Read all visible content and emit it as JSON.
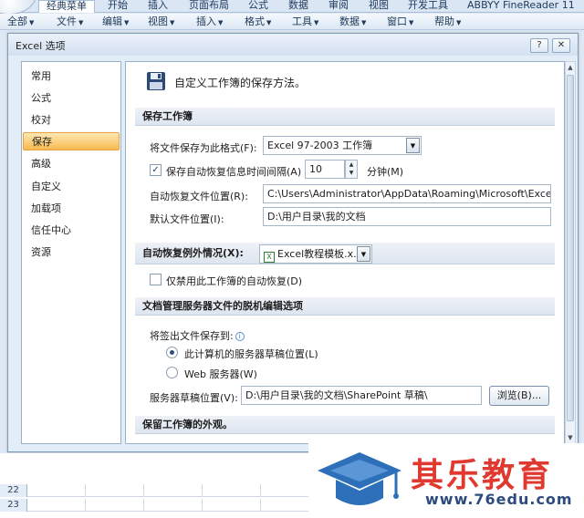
{
  "ribbon": {
    "tabs": [
      "经典菜单",
      "开始",
      "插入",
      "页面布局",
      "公式",
      "数据",
      "审阅",
      "视图",
      "开发工具",
      "ABBYY FineReader 11"
    ]
  },
  "menubar": {
    "items": [
      "全部",
      "文件",
      "编辑",
      "视图",
      "插入",
      "格式",
      "工具",
      "数据",
      "窗口",
      "帮助"
    ]
  },
  "dialog": {
    "title": "Excel 选项",
    "help_btn": "?",
    "close_btn": "✕"
  },
  "nav": {
    "items": [
      "常用",
      "公式",
      "校对",
      "保存",
      "高级",
      "自定义",
      "加载项",
      "信任中心",
      "资源"
    ],
    "selected": "保存"
  },
  "content": {
    "header": "自定义工作簿的保存方法。",
    "section_save": "保存工作簿",
    "format_label": "将文件保存为此格式(F):",
    "format_value": "Excel 97-2003 工作簿",
    "autorecover_label": "保存自动恢复信息时间间隔(A)",
    "autorecover_checked": true,
    "autorecover_minutes": "10",
    "minutes_label": "分钟(M)",
    "autorecover_location_label": "自动恢复文件位置(R):",
    "autorecover_location_value": "C:\\Users\\Administrator\\AppData\\Roaming\\Microsoft\\Excel\\",
    "default_location_label": "默认文件位置(I):",
    "default_location_value": "D:\\用户目录\\我的文档",
    "exception_label": "自动恢复例外情况(X):",
    "exception_value": "Excel教程模板.x...",
    "disable_autorecover_label": "仅禁用此工作簿的自动恢复(D)",
    "disable_autorecover_checked": false,
    "section_offline": "文档管理服务器文件的脱机编辑选项",
    "checkout_label": "将签出文件保存到:",
    "radio_server_drafts": "此计算机的服务器草稿位置(L)",
    "radio_web_server": "Web 服务器(W)",
    "server_drafts_label": "服务器草稿位置(V):",
    "server_drafts_value": "D:\\用户目录\\我的文档\\SharePoint 草稿\\",
    "browse_btn": "浏览(B)...",
    "section_appearance": "保留工作簿的外观。"
  },
  "sheet": {
    "rows": [
      "22",
      "23"
    ]
  },
  "watermark": {
    "title": "其乐教育",
    "url": "www.76edu.com"
  },
  "colors": {
    "selected_nav": "#f8b951",
    "watermark_red": "#e03a30",
    "watermark_blue": "#2d6fb8"
  }
}
